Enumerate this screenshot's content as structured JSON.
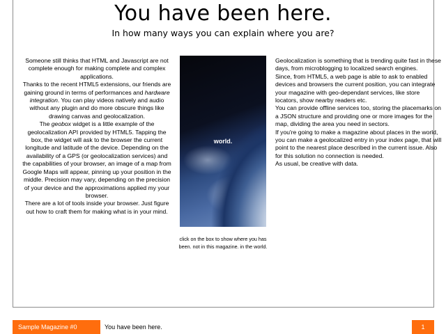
{
  "header": {
    "title": "You have been here.",
    "subtitle": "In how many ways you can explain where you are?"
  },
  "left_column": {
    "p1": "Someone still thinks that HTML and Javascript are not complete enough for making complete and complex applications.",
    "p2_a": "Thanks to the recent HTML5 extensions, our friends are gaining ground in terms of performances and ",
    "p2_em": "hardware integration",
    "p2_b": ". You can play videos natively and audio without any plugin and do more obscure things like drawing canvas and geolocalization.",
    "p3_a": "The ",
    "p3_em": "geobox",
    "p3_b": " widget is a little example of the geolocalization API provided by HTML5. Tapping the box, the widget will ask to the browser the current longitude and latitude of the device. Depending on the availability of a GPS (or geolocalization services) and the capabilities of your browser, an image of a map from Google Maps will appear, pinning up your position in the middle. Precision may vary, depending on the precision of your device and the approximations applied my your browser.",
    "p4": "There are a lot of tools inside your browser. Just figure out how to craft them for making what is in your mind."
  },
  "widget": {
    "label": "world.",
    "caption": "click on the box to show where you has been. not in this magazine. in the world."
  },
  "right_column": {
    "p1": "Geolocalization is something that is trending quite fast in these days, from microblogging to localized search engines.",
    "p2": "Since, from HTML5, a web page is able to ask to enabled devices and browsers the current position, you can integrate your magazine with geo-dependant services, like store locators, show nearby readers etc.",
    "p3": "You can provide offline services too, storing the placemarks on a JSON structure and providing one or more images for the map, dividing the area you need in sectors.",
    "p4": "If you're going to make a magazine about places in the world, you can make a geolocalized entry in your index page, that will point to the nearest place described in the current issue. Also for this solution no connection is needed.",
    "p5": "As usual, be creative with data."
  },
  "footer": {
    "brand": "Sample Magazine #0",
    "title": "You have been here.",
    "page_number": "1"
  },
  "colors": {
    "accent": "#ff6d0d",
    "frame": "#8c8c8c"
  }
}
